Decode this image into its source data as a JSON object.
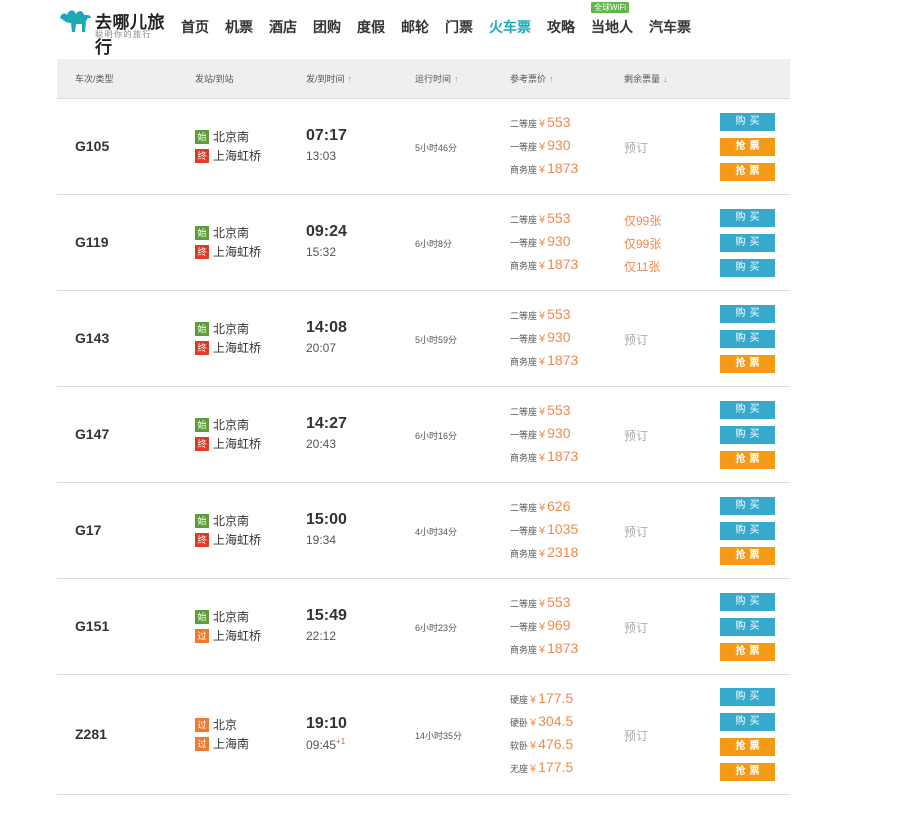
{
  "header": {
    "logo_text": "去哪儿旅行",
    "logo_slogan": "聪明你的旅行",
    "wifi_badge": "全球WiFi",
    "nav": [
      "首页",
      "机票",
      "酒店",
      "团购",
      "度假",
      "邮轮",
      "门票",
      "火车票",
      "攻略",
      "当地人",
      "汽车票"
    ],
    "active_nav": "火车票"
  },
  "columns": {
    "train": "车次/类型",
    "station": "发站/到站",
    "time": "发/到时间",
    "duration": "运行时间",
    "price": "参考票价",
    "remain": "剩余票量"
  },
  "tags": {
    "start": "始",
    "end": "终",
    "pass": "过"
  },
  "buttons": {
    "buy": "购买",
    "grab": "抢票"
  },
  "trains": [
    {
      "no": "G105",
      "from_tag": "始",
      "from": "北京南",
      "to_tag": "终",
      "to": "上海虹桥",
      "dep": "07:17",
      "arr": "13:03",
      "arr_plus": "",
      "duration": "5小时46分",
      "prices": [
        {
          "seat": "二等座",
          "price": "553"
        },
        {
          "seat": "一等座",
          "price": "930"
        },
        {
          "seat": "商务座",
          "price": "1873"
        }
      ],
      "remain": [
        {
          "text": "预订"
        }
      ],
      "actions": [
        "购买",
        "抢票",
        "抢票"
      ]
    },
    {
      "no": "G119",
      "from_tag": "始",
      "from": "北京南",
      "to_tag": "终",
      "to": "上海虹桥",
      "dep": "09:24",
      "arr": "15:32",
      "arr_plus": "",
      "duration": "6小时8分",
      "prices": [
        {
          "seat": "二等座",
          "price": "553"
        },
        {
          "seat": "一等座",
          "price": "930"
        },
        {
          "seat": "商务座",
          "price": "1873"
        }
      ],
      "remain": [
        {
          "text": "仅99张"
        },
        {
          "text": "仅99张"
        },
        {
          "text": "仅11张"
        }
      ],
      "actions": [
        "购买",
        "购买",
        "购买"
      ]
    },
    {
      "no": "G143",
      "from_tag": "始",
      "from": "北京南",
      "to_tag": "终",
      "to": "上海虹桥",
      "dep": "14:08",
      "arr": "20:07",
      "arr_plus": "",
      "duration": "5小时59分",
      "prices": [
        {
          "seat": "二等座",
          "price": "553"
        },
        {
          "seat": "一等座",
          "price": "930"
        },
        {
          "seat": "商务座",
          "price": "1873"
        }
      ],
      "remain": [
        {
          "text": "预订"
        }
      ],
      "actions": [
        "购买",
        "购买",
        "抢票"
      ]
    },
    {
      "no": "G147",
      "from_tag": "始",
      "from": "北京南",
      "to_tag": "终",
      "to": "上海虹桥",
      "dep": "14:27",
      "arr": "20:43",
      "arr_plus": "",
      "duration": "6小时16分",
      "prices": [
        {
          "seat": "二等座",
          "price": "553"
        },
        {
          "seat": "一等座",
          "price": "930"
        },
        {
          "seat": "商务座",
          "price": "1873"
        }
      ],
      "remain": [
        {
          "text": "预订"
        }
      ],
      "actions": [
        "购买",
        "购买",
        "抢票"
      ]
    },
    {
      "no": "G17",
      "from_tag": "始",
      "from": "北京南",
      "to_tag": "终",
      "to": "上海虹桥",
      "dep": "15:00",
      "arr": "19:34",
      "arr_plus": "",
      "duration": "4小时34分",
      "prices": [
        {
          "seat": "二等座",
          "price": "626"
        },
        {
          "seat": "一等座",
          "price": "1035"
        },
        {
          "seat": "商务座",
          "price": "2318"
        }
      ],
      "remain": [
        {
          "text": "预订"
        }
      ],
      "actions": [
        "购买",
        "购买",
        "抢票"
      ]
    },
    {
      "no": "G151",
      "from_tag": "始",
      "from": "北京南",
      "to_tag": "过",
      "to": "上海虹桥",
      "dep": "15:49",
      "arr": "22:12",
      "arr_plus": "",
      "duration": "6小时23分",
      "prices": [
        {
          "seat": "二等座",
          "price": "553"
        },
        {
          "seat": "一等座",
          "price": "969"
        },
        {
          "seat": "商务座",
          "price": "1873"
        }
      ],
      "remain": [
        {
          "text": "预订"
        }
      ],
      "actions": [
        "购买",
        "购买",
        "抢票"
      ]
    },
    {
      "no": "Z281",
      "from_tag": "过",
      "from": "北京",
      "to_tag": "过",
      "to": "上海南",
      "dep": "19:10",
      "arr": "09:45",
      "arr_plus": "+1",
      "duration": "14小时35分",
      "prices": [
        {
          "seat": "硬座",
          "price": "177.5"
        },
        {
          "seat": "硬卧",
          "price": "304.5"
        },
        {
          "seat": "软卧",
          "price": "476.5"
        },
        {
          "seat": "无座",
          "price": "177.5"
        }
      ],
      "remain": [
        {
          "text": "预订"
        }
      ],
      "actions": [
        "购买",
        "购买",
        "抢票",
        "抢票"
      ]
    }
  ]
}
